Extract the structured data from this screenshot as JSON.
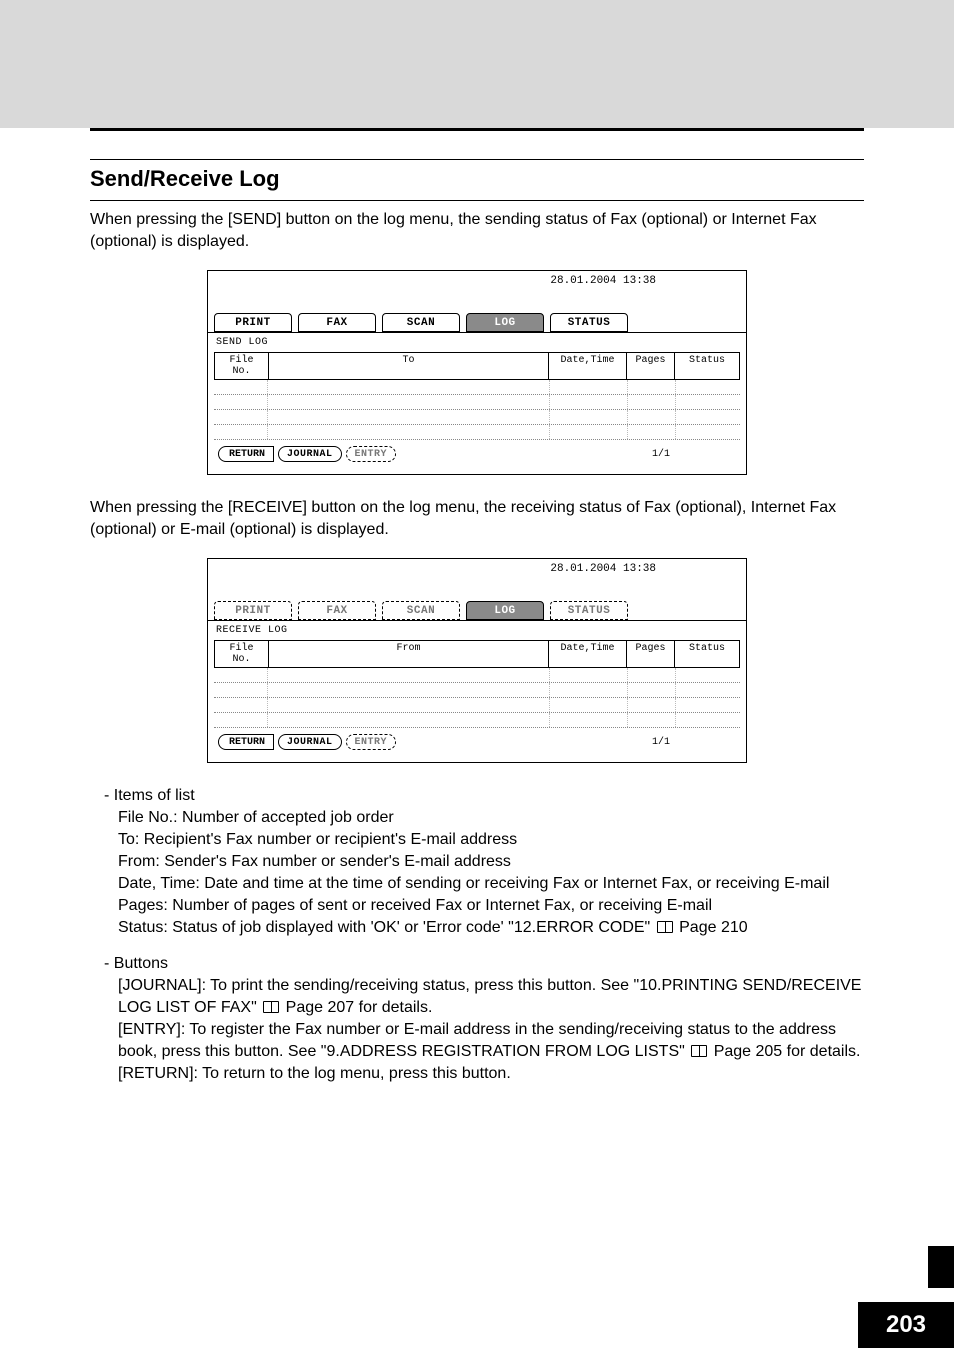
{
  "section": {
    "title": "Send/Receive Log"
  },
  "para": {
    "send_intro": "When pressing the [SEND] button on the log menu, the sending status of Fax (optional) or Internet Fax (optional) is displayed.",
    "receive_intro": "When pressing the [RECEIVE] button on the log menu, the receiving status of Fax (optional), Internet Fax (optional) or E-mail (optional) is displayed."
  },
  "lcd": {
    "timestamp": "28.01.2004 13:38",
    "tabs": {
      "print": "PRINT",
      "fax": "FAX",
      "scan": "SCAN",
      "log": "LOG",
      "status": "STATUS"
    },
    "send_subtitle": "SEND LOG",
    "receive_subtitle": "RECEIVE LOG",
    "columns": {
      "file_no": "File No.",
      "to": "To",
      "from": "From",
      "datetime": "Date,Time",
      "pages": "Pages",
      "status": "Status"
    },
    "buttons": {
      "return": "RETURN",
      "journal": "JOURNAL",
      "entry": "ENTRY"
    },
    "page_indicator": "1/1"
  },
  "items": {
    "heading": "-  Items of list",
    "file_no": "File No.: Number of accepted job order",
    "to": "To: Recipient's Fax number or recipient's E-mail address",
    "from": "From: Sender's Fax number or sender's E-mail address",
    "datetime": "Date, Time: Date and time at the time of sending or receiving Fax or Internet Fax, or receiving E-mail",
    "pages": "Pages: Number of pages of sent or received Fax or Internet Fax, or receiving E-mail",
    "status_a": "Status: Status of job displayed with 'OK' or 'Error code' \"12.ERROR CODE\"",
    "status_b": " Page 210"
  },
  "buttons_section": {
    "heading": "-  Buttons",
    "journal_a": "[JOURNAL]: To print the sending/receiving status, press this button. See \"10.PRINTING SEND/RECEIVE LOG LIST OF FAX\"",
    "journal_b": " Page 207 for details.",
    "entry_a": "[ENTRY]: To register the Fax number or E-mail address in the sending/receiving status to the address book, press this button. See \"9.ADDRESS REGISTRATION FROM LOG LISTS\"",
    "entry_b": " Page 205 for details.",
    "return": "[RETURN]: To return to the log menu, press this button."
  },
  "page_number": "203"
}
